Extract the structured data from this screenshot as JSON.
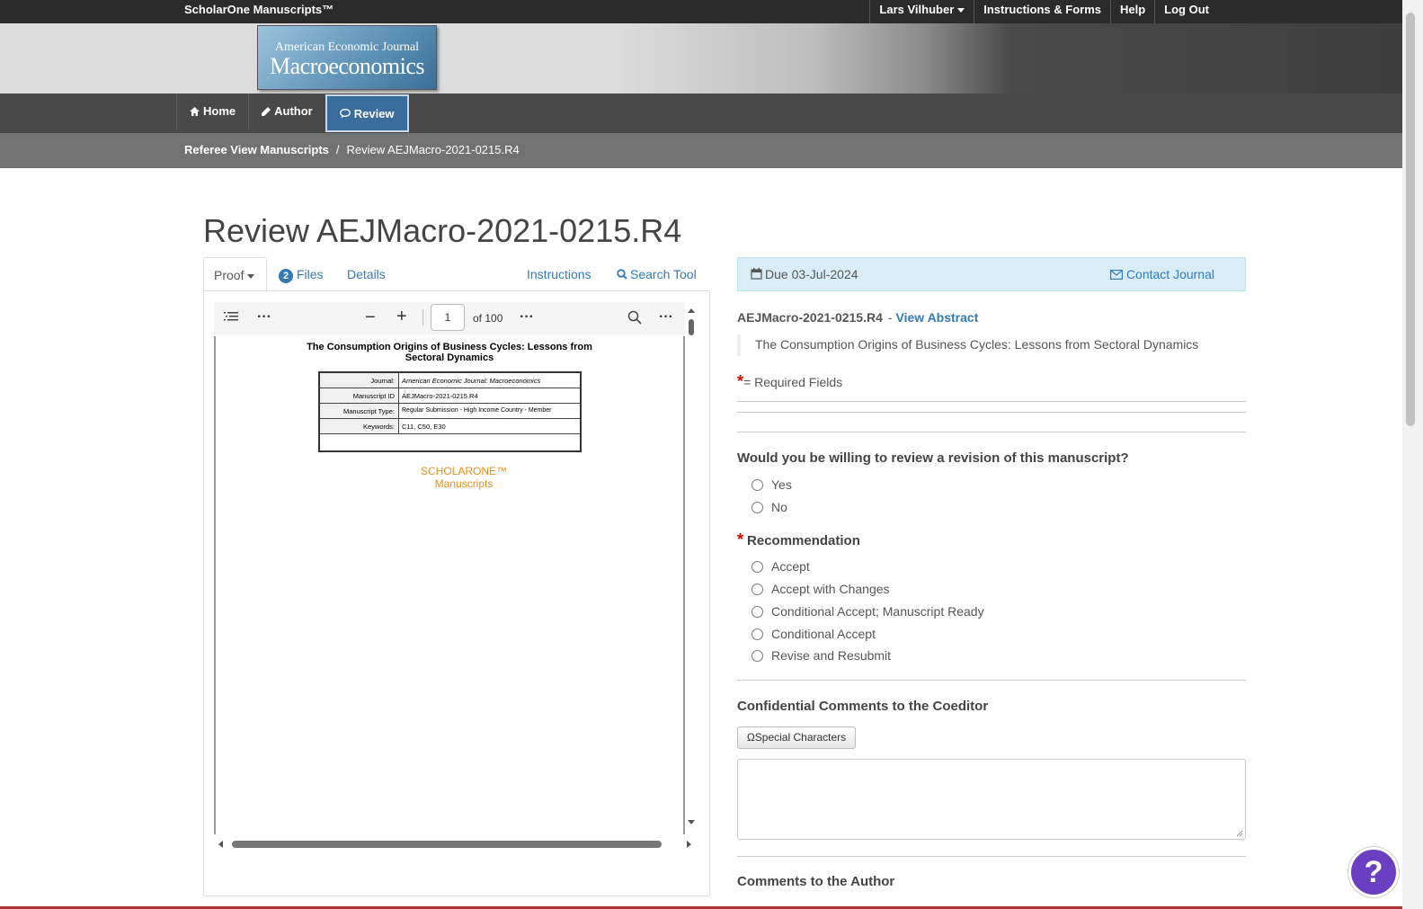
{
  "topbar": {
    "brand": "ScholarOne Manuscripts™",
    "user": "Lars Vilhuber",
    "instructions": "Instructions & Forms",
    "help": "Help",
    "logout": "Log Out"
  },
  "logo": {
    "line1": "American Economic Journal",
    "line2": "Macroeconomics"
  },
  "nav": {
    "home": "Home",
    "author": "Author",
    "review": "Review"
  },
  "breadcrumb": {
    "parent": "Referee View Manuscripts",
    "separator": "/",
    "current": "Review AEJMacro-2021-0215.R4"
  },
  "page_title": "Review AEJMacro-2021-0215.R4",
  "left_tabs": {
    "proof": "Proof",
    "files_count": "2",
    "files": "Files",
    "details": "Details",
    "instructions": "Instructions",
    "search_tool": "Search Tool"
  },
  "pdf": {
    "page": "1",
    "of": "of 100",
    "doc_title_line1": "The Consumption Origins of Business Cycles: Lessons from",
    "doc_title_line2": "Sectoral Dynamics",
    "table": [
      {
        "k": "Journal:",
        "v": "American Economic Journal: Macroeconomics"
      },
      {
        "k": "Manuscript ID",
        "v": "AEJMacro-2021-0215.R4"
      },
      {
        "k": "Manuscript Type:",
        "v": "Regular Submission - High Income Country - Member"
      },
      {
        "k": "Keywords:",
        "v": "C11, C50, E30"
      }
    ],
    "logo_line1": "SCHOLARONE™",
    "logo_line2": "Manuscripts"
  },
  "info": {
    "due": "Due 03-Jul-2024",
    "contact": "Contact Journal"
  },
  "manuscript": {
    "id": "AEJMacro-2021-0215.R4",
    "dash": "-",
    "view_abstract": "View Abstract",
    "title": "The Consumption Origins of Business Cycles: Lessons from Sectoral Dynamics"
  },
  "required": {
    "star": "*",
    "text": "= Required Fields"
  },
  "q1": {
    "label": "Would you be willing to review a revision of this manuscript?",
    "options": [
      "Yes",
      "No"
    ]
  },
  "q2": {
    "star": "*",
    "label": "Recommendation",
    "options": [
      "Accept",
      "Accept with Changes",
      "Conditional Accept; Manuscript Ready",
      "Conditional Accept",
      "Revise and Resubmit"
    ]
  },
  "coeditor": {
    "label": "Confidential Comments to the Coeditor",
    "special_chars": "ΩSpecial Characters"
  },
  "author_comments": {
    "label": "Comments to the Author"
  },
  "help_fab": "?",
  "colors": {
    "accent": "#337ab7",
    "nav_active": "#3a6d9e",
    "help_fab": "#6a3fc1"
  }
}
